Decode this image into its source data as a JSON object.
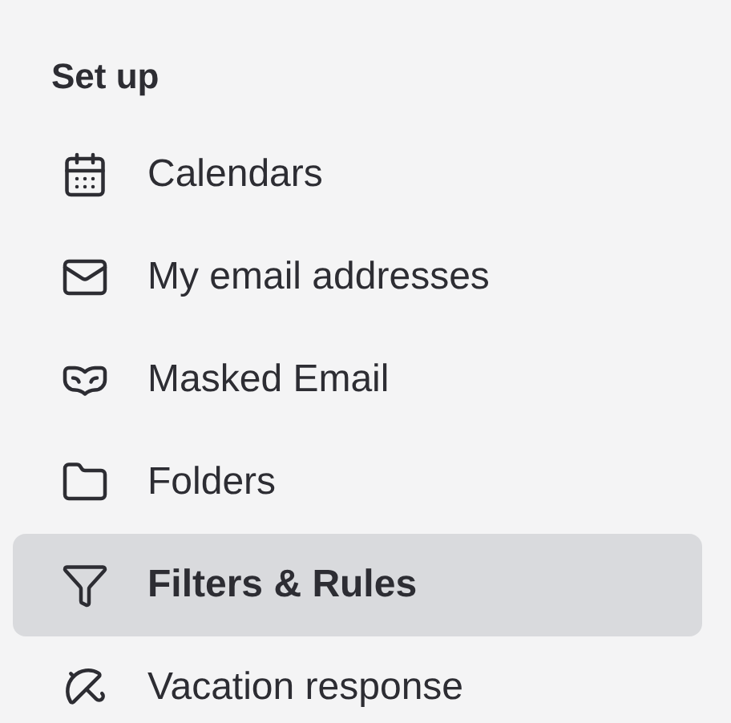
{
  "section": {
    "heading": "Set up"
  },
  "items": [
    {
      "label": "Calendars",
      "kind": "calendar",
      "selected": false
    },
    {
      "label": "My email addresses",
      "kind": "mail",
      "selected": false
    },
    {
      "label": "Masked Email",
      "kind": "mask",
      "selected": false
    },
    {
      "label": "Folders",
      "kind": "folder",
      "selected": false
    },
    {
      "label": "Filters & Rules",
      "kind": "filter",
      "selected": true
    },
    {
      "label": "Vacation response",
      "kind": "vacation",
      "selected": false
    }
  ]
}
